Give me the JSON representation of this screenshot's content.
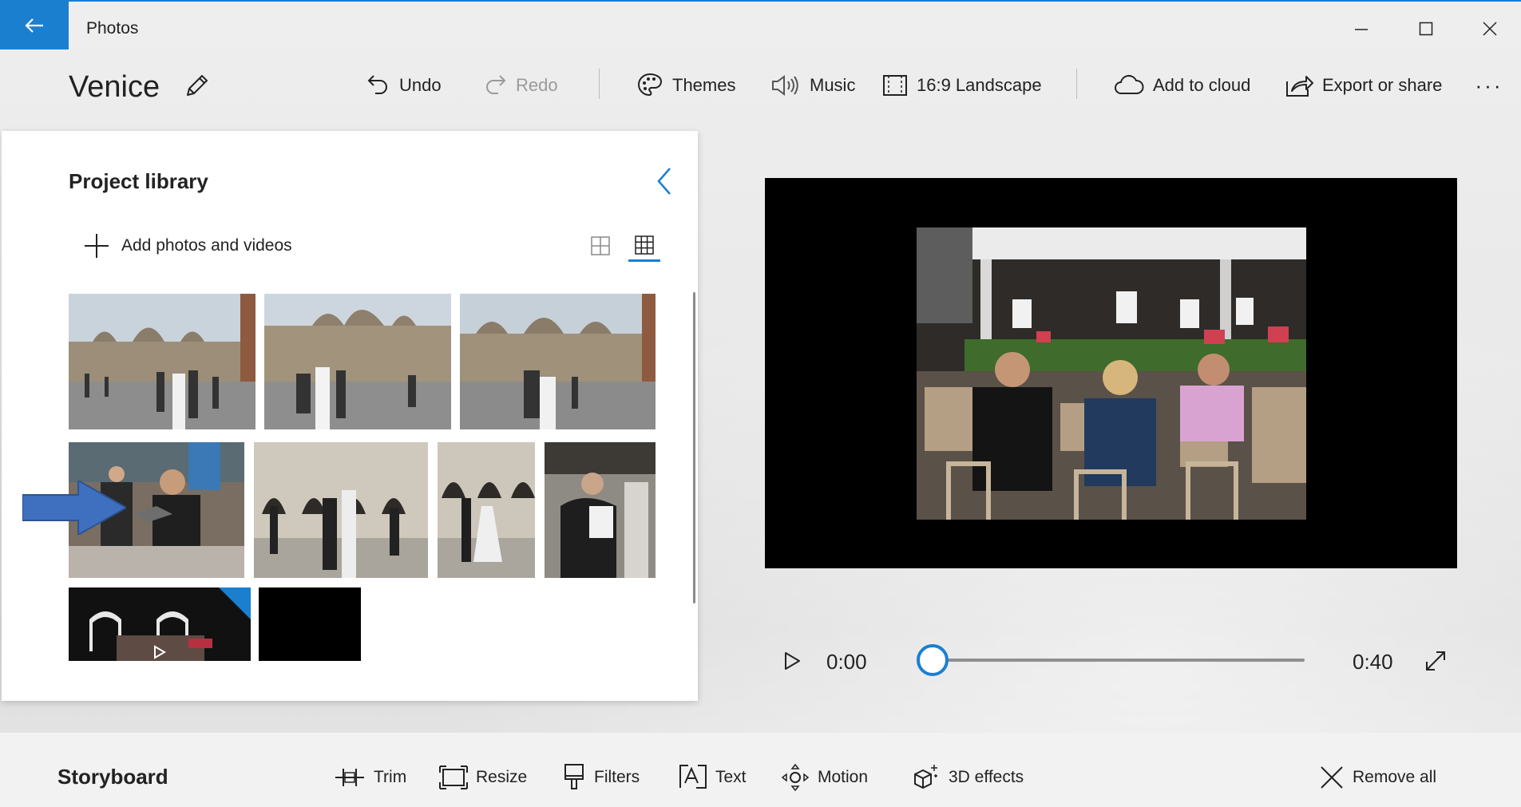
{
  "window": {
    "app_title": "Photos",
    "back_icon": "back-arrow-icon",
    "controls": [
      "minimize-icon",
      "maximize-icon",
      "close-icon"
    ]
  },
  "toolbar": {
    "project_title": "Venice",
    "undo": "Undo",
    "redo": "Redo",
    "themes": "Themes",
    "music": "Music",
    "aspect": "16:9 Landscape",
    "add_to_cloud": "Add to cloud",
    "export": "Export or share",
    "more": "···"
  },
  "library": {
    "title": "Project library",
    "add_label": "Add photos and videos",
    "view_selected": "small-grid"
  },
  "playback": {
    "current_time": "0:00",
    "total_time": "0:40",
    "progress": 0.0
  },
  "storyboard": {
    "title": "Storyboard",
    "trim": "Trim",
    "resize": "Resize",
    "filters": "Filters",
    "text": "Text",
    "motion": "Motion",
    "effects_3d": "3D effects",
    "remove_all": "Remove all"
  },
  "colors": {
    "accent": "#1b7fd0",
    "marker_arrow": "#3f6fbf"
  }
}
